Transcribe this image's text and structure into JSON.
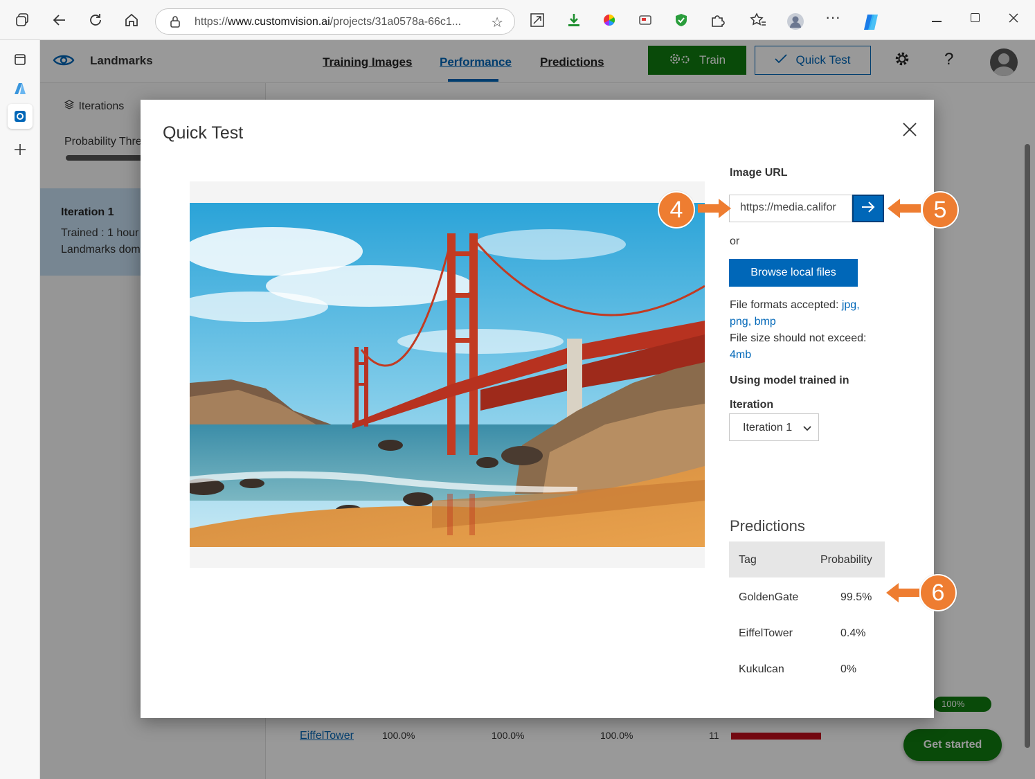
{
  "browser": {
    "url_prefix": "https://",
    "url_host": "www.customvision.ai",
    "url_path": "/projects/31a0578a-66c1..."
  },
  "app": {
    "project_name": "Landmarks",
    "tabs": [
      {
        "label": "Training Images",
        "active": false
      },
      {
        "label": "Performance",
        "active": true
      },
      {
        "label": "Predictions",
        "active": false
      }
    ],
    "train_label": "Train",
    "quicktest_label": "Quick Test",
    "help_label": "?",
    "brand_color": "#0067b8",
    "train_color": "#107c10"
  },
  "left_panel": {
    "iterations_label": "Iterations",
    "probability_label": "Probability Thre",
    "iteration_title": "Iteration 1",
    "iteration_trained": "Trained : 1 hour",
    "iteration_domain": "Landmarks dom"
  },
  "background_table": {
    "tag": "EiffelTower",
    "precision": "100.0%",
    "recall": "100.0%",
    "ap": "100.0%",
    "image_count": "11",
    "progress_label": "100%",
    "get_started": "Get started"
  },
  "modal": {
    "title": "Quick Test",
    "image_url_label": "Image URL",
    "image_url_value": "https://media.califor",
    "or_label": "or",
    "browse_label": "Browse local files",
    "formats_prefix": "File formats accepted: ",
    "formats_links": "jpg, png, bmp",
    "size_prefix": "File size should not exceed: ",
    "size_value": "4mb",
    "using_model_label": "Using model trained in",
    "iteration_label": "Iteration",
    "iteration_value": "Iteration 1",
    "predictions_title": "Predictions",
    "table_headers": {
      "tag": "Tag",
      "probability": "Probability"
    },
    "predictions": [
      {
        "tag": "GoldenGate",
        "probability": "99.5%"
      },
      {
        "tag": "EiffelTower",
        "probability": "0.4%"
      },
      {
        "tag": "Kukulcan",
        "probability": "0%"
      }
    ]
  },
  "callouts": {
    "step4": "4",
    "step5": "5",
    "step6": "6",
    "color": "#ee7d31"
  }
}
